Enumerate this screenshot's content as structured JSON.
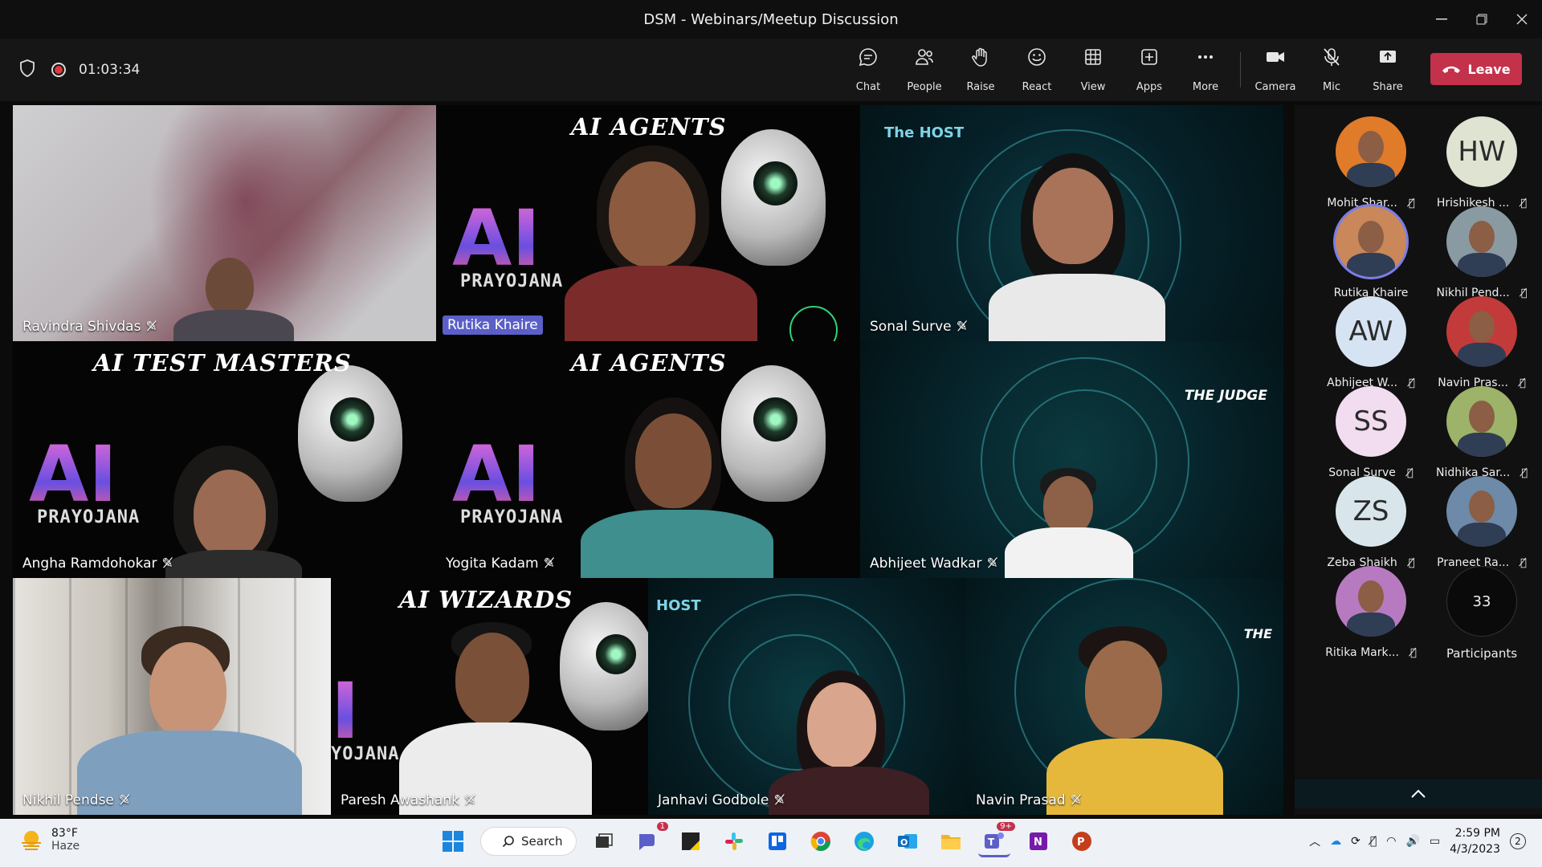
{
  "window": {
    "title": "DSM - Webinars/Meetup Discussion"
  },
  "toolbar": {
    "timer": "01:03:34",
    "buttons": {
      "chat": "Chat",
      "people": "People",
      "raise": "Raise",
      "react": "React",
      "view": "View",
      "apps": "Apps",
      "more": "More",
      "camera": "Camera",
      "mic": "Mic",
      "share": "Share"
    },
    "leave": "Leave"
  },
  "tiles": {
    "t1": {
      "name": "Ravindra Shivdas"
    },
    "t2": {
      "name": "Rutika Khaire",
      "banner": "AI AGENTS",
      "logo": "AI",
      "logo_sub": "PRAYOJANA"
    },
    "t3": {
      "name": "Sonal Surve",
      "tag": "The HOST"
    },
    "t4": {
      "name": "Angha Ramdohokar",
      "banner": "AI TEST MASTERS",
      "logo": "AI",
      "logo_sub": "PRAYOJANA"
    },
    "t5": {
      "name": "Yogita Kadam",
      "banner": "AI AGENTS",
      "logo": "AI",
      "logo_sub": "PRAYOJANA"
    },
    "t6": {
      "name": "Abhijeet Wadkar",
      "tag": "THE JUDGE"
    },
    "t7": {
      "name": "Nikhil Pendse"
    },
    "t8": {
      "name": "Paresh Awashank",
      "banner": "AI WIZARDS",
      "logo": "I",
      "logo_sub": "YOJANA"
    },
    "t9": {
      "name": "Janhavi Godbole",
      "tag": "HOST"
    },
    "t10": {
      "name": "Navin Prasad",
      "tag": "THE"
    }
  },
  "participants": [
    {
      "name": "Mohit Shar...",
      "initials": "",
      "color": "#e07b2a"
    },
    {
      "name": "Hrishikesh ...",
      "initials": "HW",
      "color": "#dfe4d2"
    },
    {
      "name": "Rutika Khaire",
      "initials": "",
      "color": "#c9875a"
    },
    {
      "name": "Nikhil Pend...",
      "initials": "",
      "color": "#8a9aa3"
    },
    {
      "name": "Abhijeet W...",
      "initials": "AW",
      "color": "#d6e3f2"
    },
    {
      "name": "Navin Pras...",
      "initials": "",
      "color": "#c33a3a"
    },
    {
      "name": "Sonal Surve",
      "initials": "SS",
      "color": "#f2dcef"
    },
    {
      "name": "Nidhika Sar...",
      "initials": "",
      "color": "#9db36a"
    },
    {
      "name": "Zeba Shaikh",
      "initials": "ZS",
      "color": "#d8e6ec"
    },
    {
      "name": "Praneet Ra...",
      "initials": "",
      "color": "#6d8aa8"
    },
    {
      "name": "Ritika Mark...",
      "initials": "",
      "color": "#b77ac0"
    }
  ],
  "participants_more": {
    "count": "33",
    "label": "Participants"
  },
  "taskbar": {
    "weather_temp": "83°F",
    "weather_cond": "Haze",
    "search": "Search",
    "teams_badge": "9+",
    "chat_badge": "1",
    "time": "2:59 PM",
    "date": "4/3/2023",
    "notif": "2"
  }
}
